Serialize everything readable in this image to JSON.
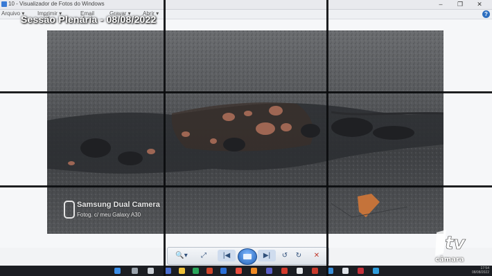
{
  "window": {
    "title": "10 - Visualizador de Fotos do Windows",
    "min_label": "–",
    "max_label": "❐",
    "close_label": "✕"
  },
  "menu": {
    "items": [
      "Arquivo ▾",
      "Imprimir ▾",
      "Email",
      "Gravar ▾",
      "Abrir ▾"
    ],
    "help_label": "?"
  },
  "overlay": {
    "session_title": "Sessão Plenária - 08/08/2022"
  },
  "photo": {
    "watermark_camera": "Samsung Dual Camera",
    "watermark_sub": "Fotog. c/ meu Galaxy A30"
  },
  "toolbar": {
    "zoom_label": "🔍▾",
    "fit_label": "⤢",
    "prev_label": "|◀",
    "next_label": "▶|",
    "rotate_left_label": "↺",
    "rotate_right_label": "↻",
    "delete_label": "✕"
  },
  "taskbar": {
    "time": "17:54",
    "date": "08/08/2022"
  },
  "logo": {
    "text": "câmara"
  },
  "colors": {
    "accent": "#2d6fc0",
    "delete": "#c0392b"
  }
}
